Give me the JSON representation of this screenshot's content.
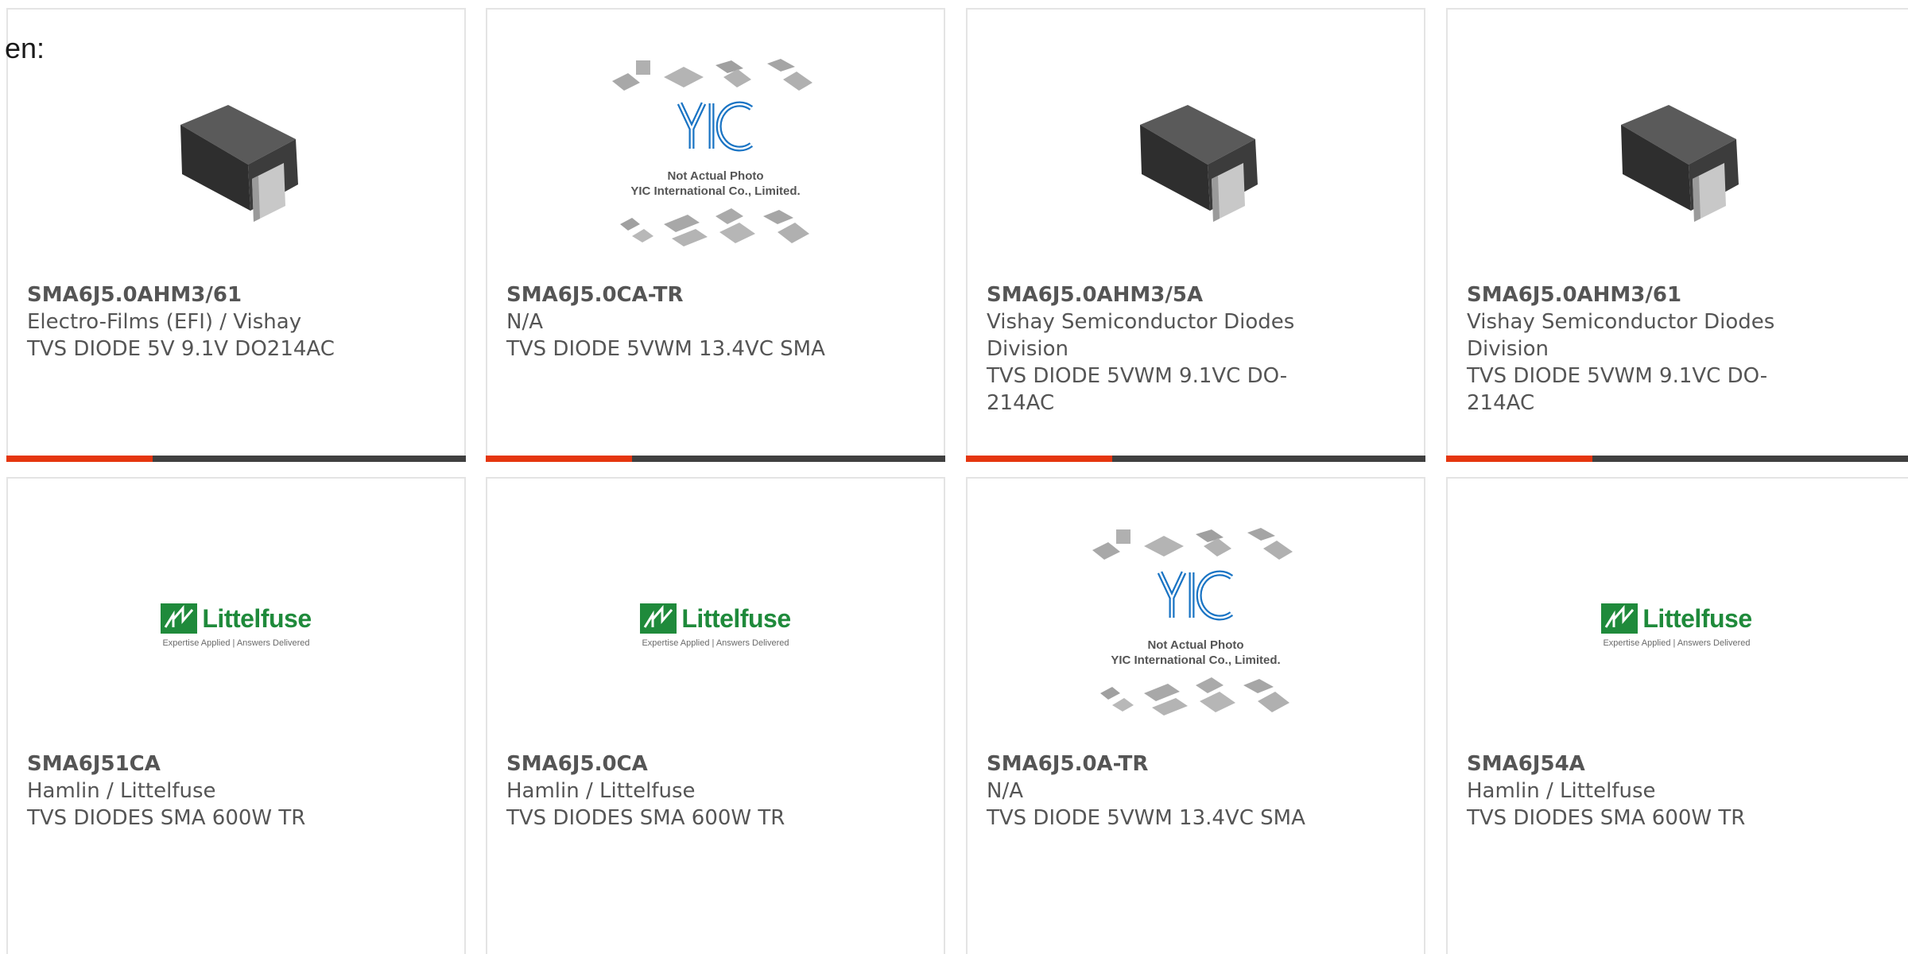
{
  "lang_label": "en:",
  "products": [
    {
      "part": "SMA6J5.0AHM3/61",
      "manufacturer": "Electro-Films (EFI) / Vishay",
      "description": "TVS DIODE 5V 9.1V DO214AC",
      "image": "diode-package-photo"
    },
    {
      "part": "SMA6J5.0CA-TR",
      "manufacturer": "N/A",
      "description": "TVS DIODE 5VWM 13.4VC SMA",
      "image": "yic-placeholder",
      "placeholder_line1": "Not Actual Photo",
      "placeholder_line2": "YIC International Co., Limited."
    },
    {
      "part": "SMA6J5.0AHM3/5A",
      "manufacturer": "Vishay Semiconductor Diodes Division",
      "description": "TVS DIODE 5VWM 9.1VC DO-214AC",
      "image": "diode-package-photo"
    },
    {
      "part": "SMA6J5.0AHM3/61",
      "manufacturer": "Vishay Semiconductor Diodes Division",
      "description": "TVS DIODE 5VWM 9.1VC DO-214AC",
      "image": "diode-package-photo"
    },
    {
      "part": "SMA6J51CA",
      "manufacturer": "Hamlin / Littelfuse",
      "description": "TVS DIODES SMA 600W TR",
      "image": "littelfuse-logo",
      "logo_name": "Littelfuse",
      "logo_tagline": "Expertise Applied | Answers Delivered"
    },
    {
      "part": "SMA6J5.0CA",
      "manufacturer": "Hamlin / Littelfuse",
      "description": "TVS DIODES SMA 600W TR",
      "image": "littelfuse-logo",
      "logo_name": "Littelfuse",
      "logo_tagline": "Expertise Applied | Answers Delivered"
    },
    {
      "part": "SMA6J5.0A-TR",
      "manufacturer": "N/A",
      "description": "TVS DIODE 5VWM 13.4VC SMA",
      "image": "yic-placeholder",
      "placeholder_line1": "Not Actual Photo",
      "placeholder_line2": "YIC International Co., Limited."
    },
    {
      "part": "SMA6J54A",
      "manufacturer": "Hamlin / Littelfuse",
      "description": "TVS DIODES SMA 600W TR",
      "image": "littelfuse-logo",
      "logo_name": "Littelfuse",
      "logo_tagline": "Expertise Applied | Answers Delivered"
    }
  ],
  "colors": {
    "accent_bar": "#e5360f",
    "dark_bar": "#404040",
    "text": "#555555",
    "littelfuse_green": "#1f8a3b",
    "yic_blue": "#1a74c4"
  }
}
